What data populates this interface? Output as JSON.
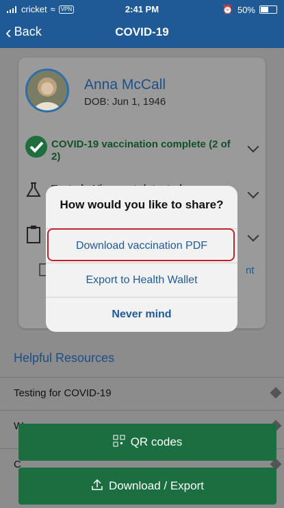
{
  "status_bar": {
    "carrier": "cricket",
    "vpn": "VPN",
    "time": "2:41 PM",
    "battery": "50%"
  },
  "nav": {
    "back_label": "Back",
    "title": "COVID-19"
  },
  "profile": {
    "name": "Anna McCall",
    "dob": "DOB: Jun 1, 1946"
  },
  "vaccination_status": "COVID-19 vaccination complete (2 of 2)",
  "test_status": "Tested - Virus not detected",
  "partial_row_suffix": "nt",
  "resources": {
    "title": "Helpful Resources",
    "items": [
      "Testing for COVID-19",
      "W",
      "C"
    ]
  },
  "buttons": {
    "qr": "QR codes",
    "download": "Download / Export"
  },
  "dialog": {
    "title": "How would you like to share?",
    "options": [
      "Download vaccination PDF",
      "Export to Health Wallet",
      "Never mind"
    ]
  },
  "colors": {
    "nav": "#1f5a96",
    "green": "#1b6e40",
    "highlight": "#c0212a"
  }
}
